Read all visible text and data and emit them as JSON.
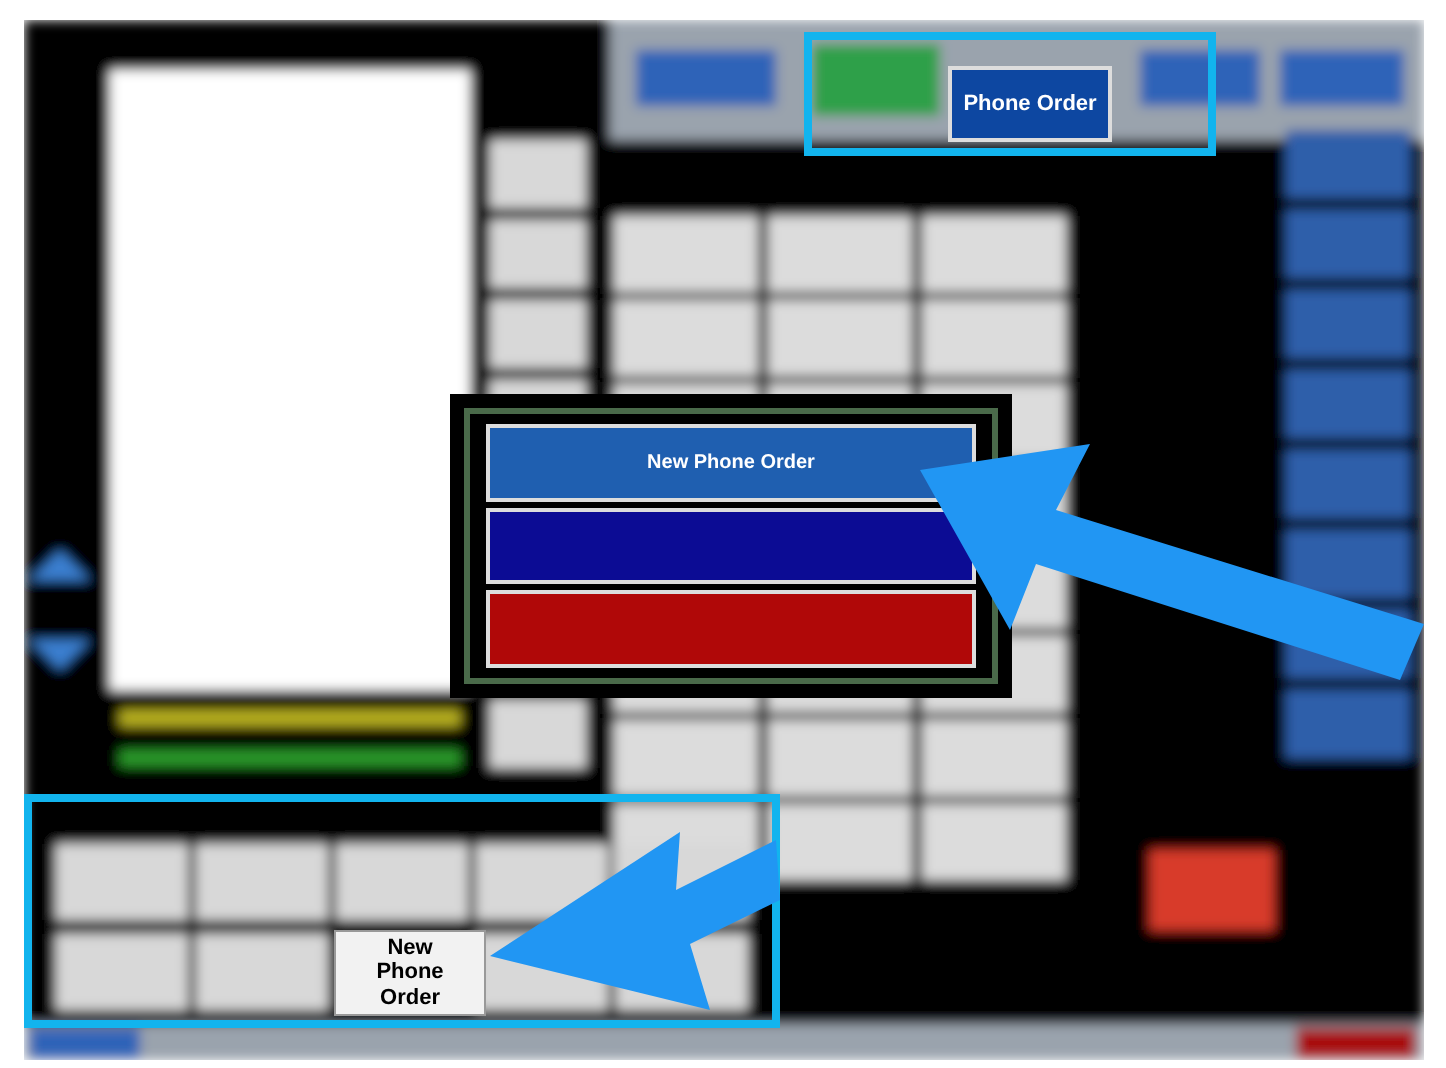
{
  "top_bar": {
    "buttons": [
      {
        "label": "Phone Order",
        "selected": true
      }
    ]
  },
  "popup": {
    "options": [
      {
        "label": "New Phone Order",
        "color": "#1f5fb0"
      },
      {
        "color": "#0c0c94"
      },
      {
        "color": "#b00808"
      }
    ]
  },
  "bottom_panel": {
    "button": {
      "label": "New Phone Order"
    }
  }
}
